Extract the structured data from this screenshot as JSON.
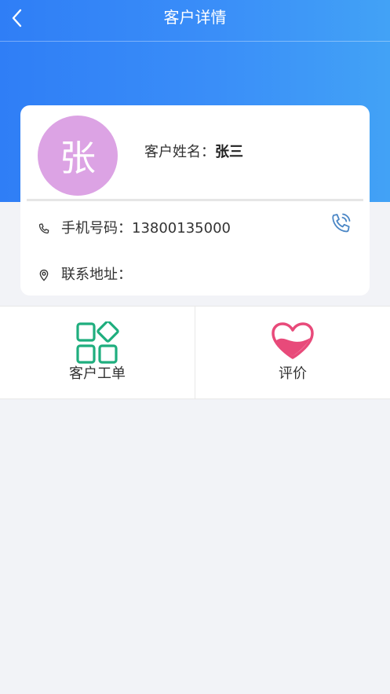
{
  "header": {
    "title": "客户详情",
    "back_icon": "chevron-left-icon"
  },
  "customer": {
    "avatar_char": "张",
    "avatar_color": "#dca3e4",
    "name_label": "客户姓名：",
    "name_value": "张三",
    "phone_label": "手机号码：",
    "phone_value": "13800135000",
    "address_label": "联系地址：",
    "address_value": ""
  },
  "actions": [
    {
      "label": "客户工单",
      "icon": "apps-grid-icon",
      "color": "#1fae7e"
    },
    {
      "label": "评价",
      "icon": "heart-icon",
      "color": "#e84a7a"
    }
  ],
  "colors": {
    "primary": "#2f7ef6",
    "background": "#f2f3f7",
    "call_icon": "#4a86c5"
  }
}
